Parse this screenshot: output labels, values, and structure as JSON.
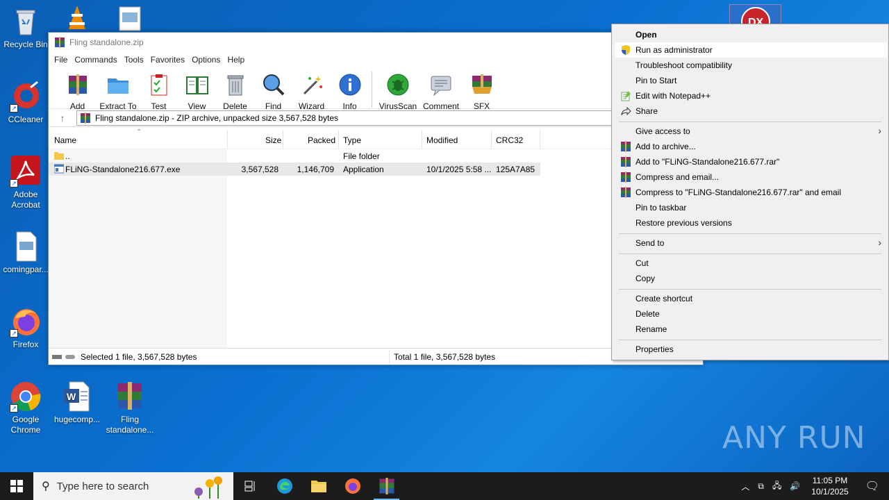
{
  "desktop": {
    "icons": [
      {
        "label": "Recycle Bin"
      },
      {
        "label": "CCleaner"
      },
      {
        "label": "Adobe Acrobat"
      },
      {
        "label": "comingpar..."
      },
      {
        "label": "Firefox"
      },
      {
        "label": "Google Chrome"
      },
      {
        "label": "hugecomp..."
      },
      {
        "label": "Fling standalone..."
      }
    ]
  },
  "window": {
    "title": "Fling standalone.zip",
    "menu": [
      "File",
      "Commands",
      "Tools",
      "Favorites",
      "Options",
      "Help"
    ],
    "toolbar": [
      "Add",
      "Extract To",
      "Test",
      "View",
      "Delete",
      "Find",
      "Wizard",
      "Info",
      "VirusScan",
      "Comment",
      "SFX"
    ],
    "address": "Fling standalone.zip - ZIP archive, unpacked size 3,567,528 bytes",
    "columns": {
      "name": "Name",
      "size": "Size",
      "packed": "Packed",
      "type": "Type",
      "modified": "Modified",
      "crc": "CRC32"
    },
    "rows": [
      {
        "name": "..",
        "size": "",
        "packed": "",
        "type": "File folder",
        "modified": "",
        "crc": ""
      },
      {
        "name": "FLiNG-Standalone216.677.exe",
        "size": "3,567,528",
        "packed": "1,146,709",
        "type": "Application",
        "modified": "10/1/2025 5:58 ...",
        "crc": "125A7A85"
      }
    ],
    "status_left": "Selected 1 file, 3,567,528 bytes",
    "status_right": "Total 1 file, 3,567,528 bytes"
  },
  "context_menu": {
    "items": [
      {
        "label": "Open",
        "icon": "none"
      },
      {
        "label": "Run as administrator",
        "icon": "shield-icon"
      },
      {
        "label": "Troubleshoot compatibility",
        "icon": "none"
      },
      {
        "label": "Pin to Start",
        "icon": "none"
      },
      {
        "label": "Edit with Notepad++",
        "icon": "notepadpp-icon"
      },
      {
        "label": "Share",
        "icon": "share-icon"
      },
      {
        "label": "Give access to",
        "icon": "none"
      },
      {
        "label": "Add to archive...",
        "icon": "winrar-icon"
      },
      {
        "label": "Add to \"FLiNG-Standalone216.677.rar\"",
        "icon": "winrar-icon"
      },
      {
        "label": "Compress and email...",
        "icon": "winrar-icon"
      },
      {
        "label": "Compress to \"FLiNG-Standalone216.677.rar\" and email",
        "icon": "winrar-icon"
      },
      {
        "label": "Pin to taskbar",
        "icon": "none"
      },
      {
        "label": "Restore previous versions",
        "icon": "none"
      },
      {
        "label": "Send to",
        "icon": "none"
      },
      {
        "label": "Cut",
        "icon": "none"
      },
      {
        "label": "Copy",
        "icon": "none"
      },
      {
        "label": "Create shortcut",
        "icon": "none"
      },
      {
        "label": "Delete",
        "icon": "none"
      },
      {
        "label": "Rename",
        "icon": "none"
      },
      {
        "label": "Properties",
        "icon": "none"
      }
    ]
  },
  "taskbar": {
    "search_placeholder": "Type here to search",
    "time": "11:05 PM",
    "date": "10/1/2025"
  },
  "watermark": "ANY RUN",
  "colors": {
    "accent": "#0a6fd0",
    "taskbar": "#1c1c1c",
    "highlight": "#ffffff"
  }
}
